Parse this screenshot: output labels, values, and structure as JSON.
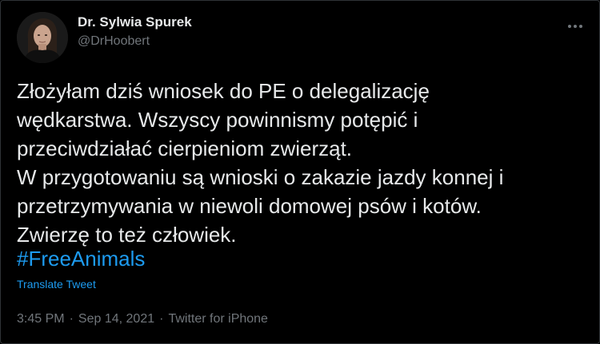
{
  "author": {
    "display_name": "Dr. Sylwia Spurek",
    "handle": "@DrHoobert"
  },
  "more_icon": "more-horizontal-icon",
  "tweet": {
    "text": "Złożyłam dziś wniosek do PE o delegalizację\nwędkarstwa. Wszyscy powinnismy potępić i\nprzeciwdziałać cierpieniom zwierząt.\nW przygotowaniu są wnioski o zakazie jazdy konnej i\nprzetrzymywania w niewoli domowej psów i kotów.\nZwierzę to też człowiek.",
    "hashtag": "#FreeAnimals",
    "translate_label": "Translate Tweet"
  },
  "meta": {
    "time": "3:45 PM",
    "separator": "·",
    "date": "Sep 14, 2021",
    "source": "Twitter for iPhone"
  },
  "colors": {
    "background": "#000000",
    "text": "#e7e9ea",
    "muted": "#71767b",
    "accent": "#1d9bf0"
  }
}
